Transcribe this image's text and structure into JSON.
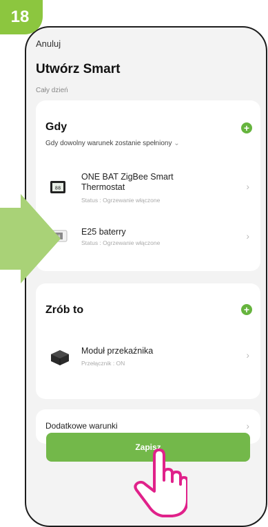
{
  "step_number": "18",
  "header": {
    "cancel": "Anuluj",
    "title": "Utwórz Smart",
    "subtitle": "Cały dzień"
  },
  "when": {
    "title": "Gdy",
    "description": "Gdy dowolny warunek zostanie spełniony",
    "conditions": [
      {
        "name": "ONE BAT ZigBee Smart Thermostat",
        "status": "Status : Ogrzewanie włączone"
      },
      {
        "name": "E25 baterry",
        "status": "Status : Ogrzewanie włączone"
      }
    ]
  },
  "then": {
    "title": "Zrób to",
    "actions": [
      {
        "name": "Moduł przekaźnika",
        "status": "Przełącznik : ON"
      }
    ]
  },
  "extra_conditions": "Dodatkowe warunki",
  "save": "Zapisz",
  "colors": {
    "accent": "#8cc63f",
    "add_button": "#66b43e",
    "save_button": "#73b84a"
  },
  "icons": [
    "hand-pointer-icon",
    "arrow-right-icon",
    "plus-icon",
    "chevron-right-icon",
    "thermostat-icon",
    "relay-module-icon"
  ]
}
